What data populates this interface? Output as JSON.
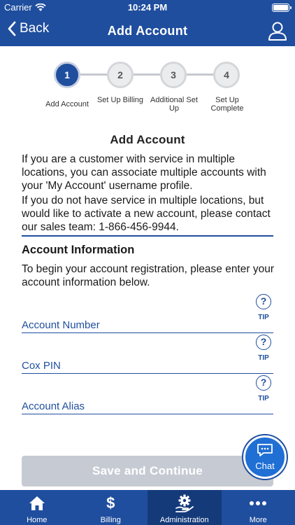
{
  "status_bar": {
    "carrier": "Carrier",
    "time": "10:24 PM"
  },
  "nav": {
    "back_label": "Back",
    "title": "Add Account"
  },
  "steps": [
    {
      "number": "1",
      "label": "Add Account"
    },
    {
      "number": "2",
      "label": "Set Up Billing"
    },
    {
      "number": "3",
      "label": "Additional Set Up"
    },
    {
      "number": "4",
      "label": "Set Up Complete"
    }
  ],
  "current_step": 1,
  "content": {
    "heading": "Add Account",
    "intro_1": "If you are a customer with service in multiple locations, you can associate multiple accounts with your 'My Account' username profile.",
    "intro_2": "If you do not have service in multiple locations, but would like to activate a new account, please contact our sales team: 1-866-456-9944."
  },
  "account_info": {
    "title": "Account Information",
    "description": "To begin your account registration, please enter your account information below.",
    "fields": [
      {
        "label": "Account Number",
        "tip": "TIP"
      },
      {
        "label": "Cox PIN",
        "tip": "TIP"
      },
      {
        "label": "Account Alias",
        "tip": "TIP"
      }
    ]
  },
  "save_button": "Save and Continue",
  "chat": {
    "label": "Chat"
  },
  "tabs": [
    {
      "label": "Home",
      "icon": "home-icon"
    },
    {
      "label": "Billing",
      "icon": "dollar-icon"
    },
    {
      "label": "Administration",
      "icon": "gear-hand-icon"
    },
    {
      "label": "More",
      "icon": "more-dots-icon"
    }
  ],
  "active_tab": "Administration",
  "colors": {
    "brand_blue": "#1f4e9e",
    "active_tab": "#143a7a",
    "disabled_button": "#c6cbd3",
    "chat_blue": "#1f6fd4"
  }
}
